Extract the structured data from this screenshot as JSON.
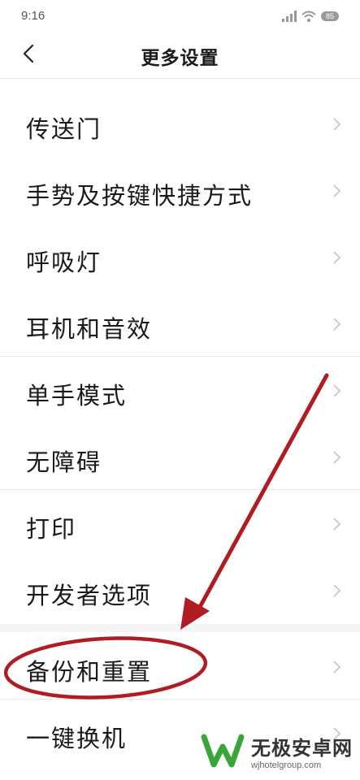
{
  "status_bar": {
    "time": "9:16",
    "battery": "85",
    "icons": [
      "signal-icon",
      "wifi-icon",
      "battery-icon"
    ]
  },
  "header": {
    "title": "更多设置",
    "back_icon": "chevron-left-icon"
  },
  "items": [
    {
      "label": "传送门"
    },
    {
      "label": "手势及按键快捷方式"
    },
    {
      "label": "呼吸灯"
    },
    {
      "label": "耳机和音效"
    },
    {
      "label": "单手模式"
    },
    {
      "label": "无障碍"
    },
    {
      "label": "打印"
    },
    {
      "label": "开发者选项"
    },
    {
      "label": "备份和重置"
    },
    {
      "label": "一键换机"
    }
  ],
  "annotation": {
    "arrow_color": "#b01c22",
    "highlighted_item": "备份和重置"
  },
  "watermark": {
    "title": "无极安卓网",
    "url": "wjhotelgroup.com"
  },
  "colors": {
    "text": "#1a1a1a",
    "separator": "#e8e8e8",
    "chevron": "#c8c8c8",
    "annotation": "#b01c22",
    "watermark_green": "#3aa63a"
  }
}
